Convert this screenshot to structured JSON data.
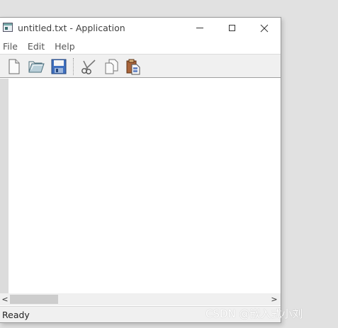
{
  "window": {
    "title": "untitled.txt - Application"
  },
  "menu": {
    "items": [
      "File",
      "Edit",
      "Help"
    ]
  },
  "toolbar": {
    "buttons": [
      {
        "icon": "new-file-icon"
      },
      {
        "icon": "open-folder-icon"
      },
      {
        "icon": "save-icon"
      },
      {
        "icon": "cut-icon"
      },
      {
        "icon": "copy-icon"
      },
      {
        "icon": "paste-icon"
      }
    ]
  },
  "editor": {
    "content": ""
  },
  "scrollbar": {
    "left_arrow": "<",
    "right_arrow": ">"
  },
  "status": {
    "text": "Ready"
  },
  "watermark": "CSDN @嵌入式小刘"
}
